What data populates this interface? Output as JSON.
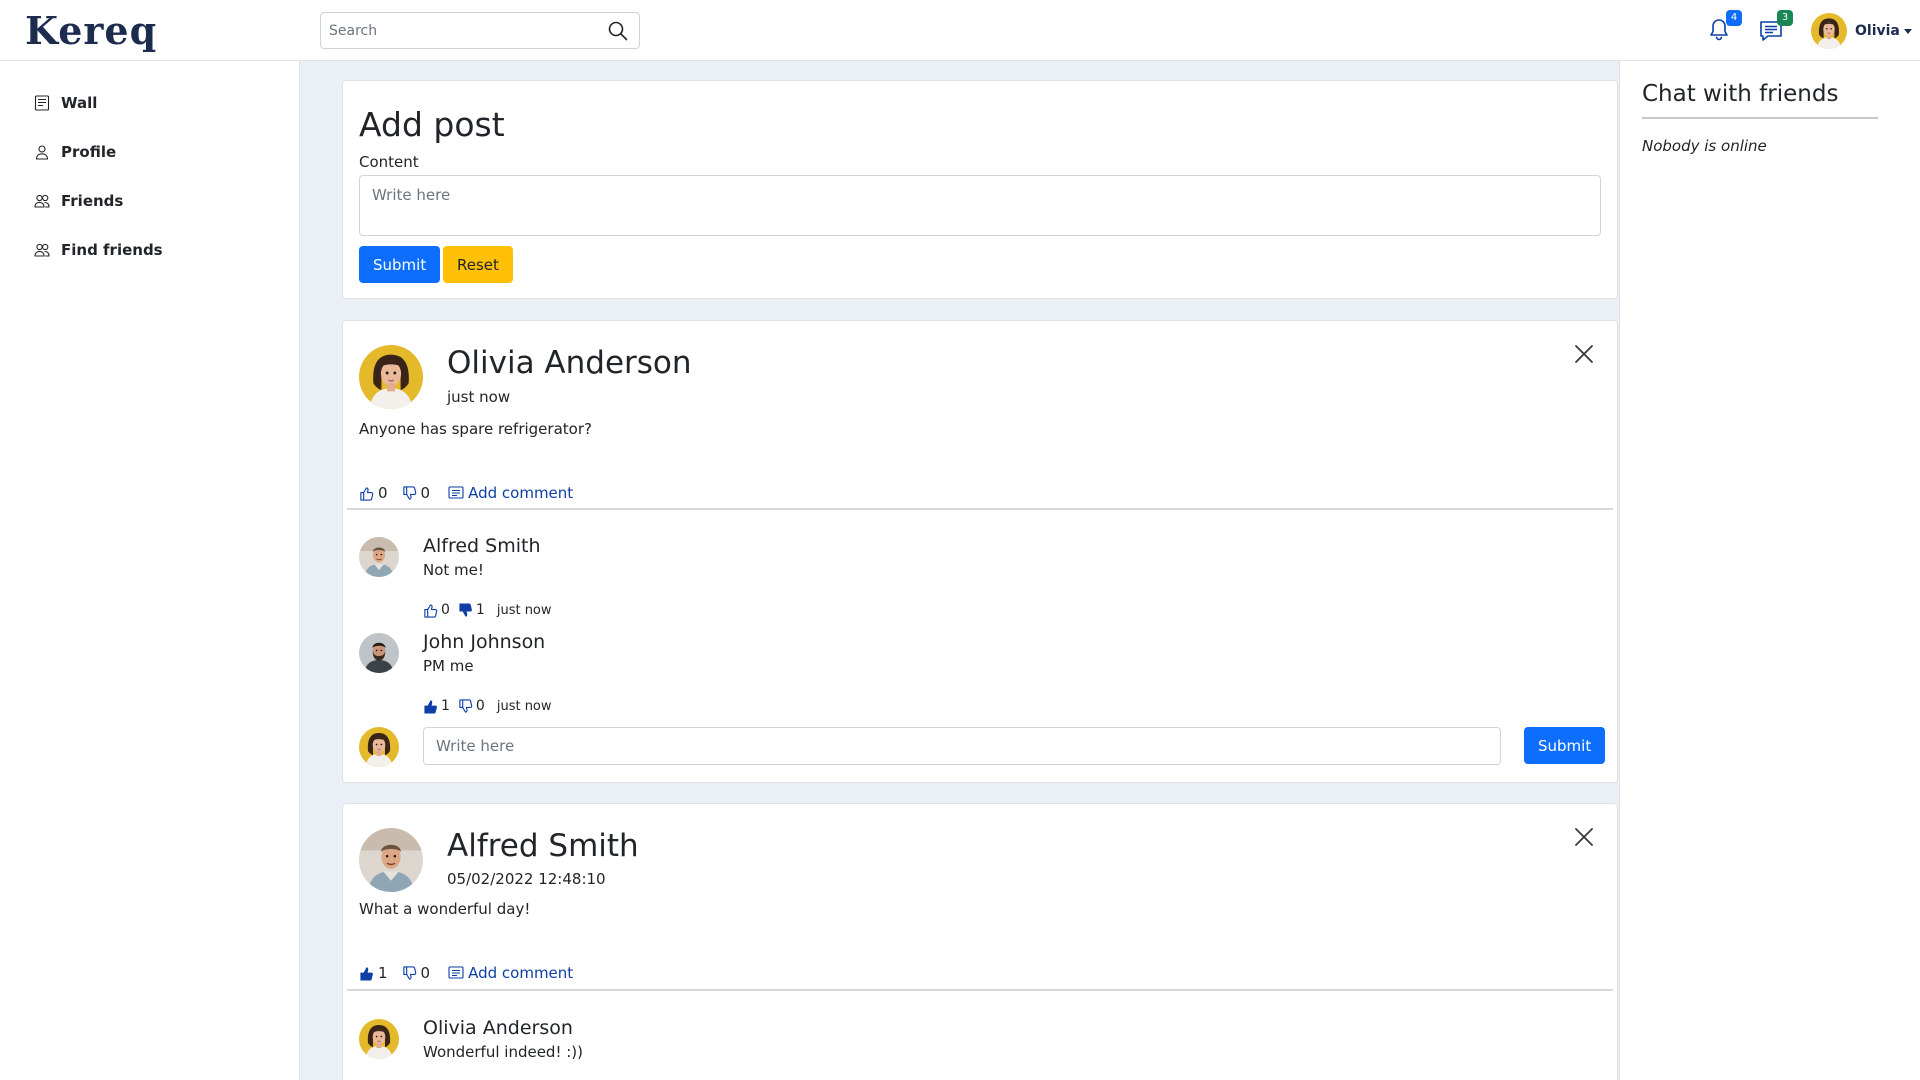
{
  "app": {
    "logo": "Kereq"
  },
  "search": {
    "placeholder": "Search"
  },
  "header": {
    "notifications_count": "4",
    "messages_count": "3",
    "user_name": "Olivia",
    "colors": {
      "notif_badge": "#0d6efd",
      "msg_badge": "#198754",
      "brand": "#1d2b4f"
    }
  },
  "sidebar": {
    "items": [
      {
        "label": "Wall",
        "icon": "wall-icon"
      },
      {
        "label": "Profile",
        "icon": "person-icon"
      },
      {
        "label": "Friends",
        "icon": "people-icon"
      },
      {
        "label": "Find friends",
        "icon": "people-icon"
      }
    ]
  },
  "add_post": {
    "title": "Add post",
    "content_label": "Content",
    "placeholder": "Write here",
    "submit_label": "Submit",
    "reset_label": "Reset"
  },
  "posts": [
    {
      "author": "Olivia Anderson",
      "time": "just now",
      "text": "Anyone has spare refrigerator?",
      "likes": "0",
      "dislikes": "0",
      "liked": false,
      "add_comment_label": "Add comment",
      "comments": [
        {
          "author": "Alfred Smith",
          "text": "Not me!",
          "likes": "0",
          "dislikes": "1",
          "liked": false,
          "disliked": true,
          "time": "just now"
        },
        {
          "author": "John Johnson",
          "text": "PM me",
          "likes": "1",
          "dislikes": "0",
          "liked": true,
          "disliked": false,
          "time": "just now"
        }
      ],
      "comment_placeholder": "Write here",
      "comment_submit": "Submit"
    },
    {
      "author": "Alfred Smith",
      "time": "05/02/2022 12:48:10",
      "text": "What a wonderful day!",
      "likes": "1",
      "dislikes": "0",
      "liked": true,
      "add_comment_label": "Add comment",
      "comments": [
        {
          "author": "Olivia Anderson",
          "text": "Wonderful indeed! :))"
        }
      ]
    }
  ],
  "chat": {
    "title": "Chat with friends",
    "empty_text": "Nobody is online"
  }
}
